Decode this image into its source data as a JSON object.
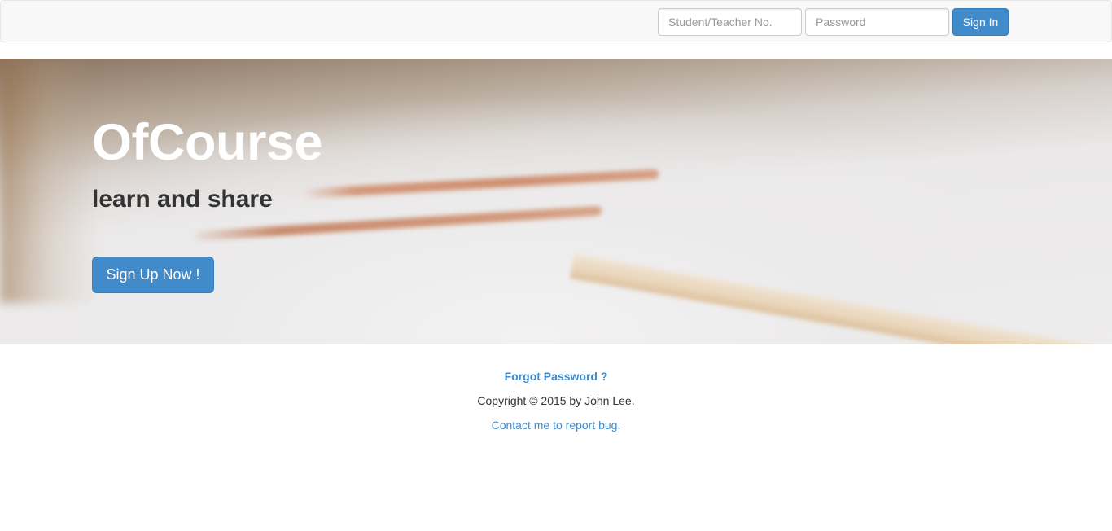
{
  "navbar": {
    "login": {
      "id_placeholder": "Student/Teacher No.",
      "password_placeholder": "Password",
      "signin_label": "Sign In"
    }
  },
  "hero": {
    "title": "OfCourse",
    "subtitle": "learn and share",
    "signup_label": "Sign Up Now !"
  },
  "footer": {
    "forgot_password": "Forgot Password ?",
    "copyright": "Copyright © 2015 by John Lee.",
    "contact": "Contact me to report bug."
  },
  "colors": {
    "accent": "#428bca",
    "navbar_bg": "#f8f8f8",
    "text_dark": "#333333"
  }
}
